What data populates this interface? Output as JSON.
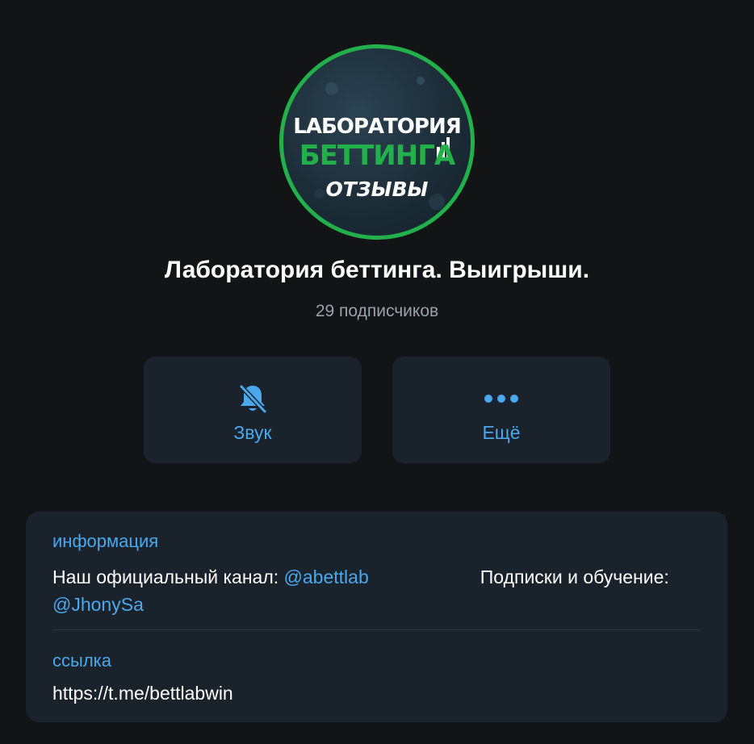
{
  "profile": {
    "avatar": {
      "line1": "LАБОРАТОРИЯ",
      "line2": "БЕТТИНГА",
      "line3": "ОТЗЫВЫ",
      "ring_color": "#22b04b"
    },
    "title": "Лаборатория беттинга. Выигрыши.",
    "subscribers": "29 подписчиков"
  },
  "actions": {
    "sound": {
      "label": "Звук",
      "icon": "bell-muted-icon"
    },
    "more": {
      "label": "Ещё",
      "icon": "more-dots-icon"
    }
  },
  "info": {
    "heading": "информация",
    "text_before_link1": "Наш официальный канал: ",
    "link1": "@abettlab",
    "text_middle": "Подписки и обучение: ",
    "link2": "@JhonySa",
    "link_heading": "ссылка",
    "link_value": "https://t.me/bettlabwin"
  },
  "colors": {
    "background": "#131416",
    "card": "#1a222c",
    "accent": "#4aa8ec",
    "muted": "#98a2ad"
  }
}
